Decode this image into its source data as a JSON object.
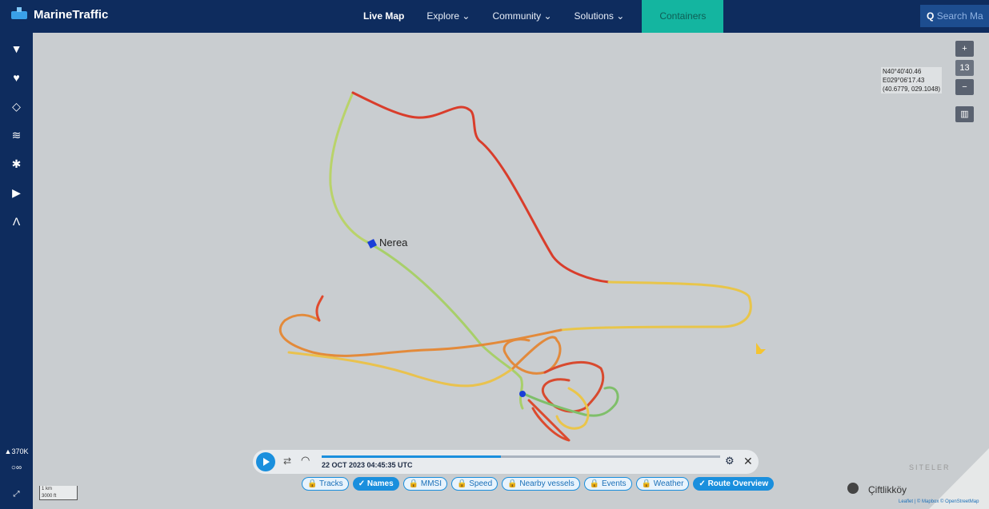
{
  "brand": {
    "name": "MarineTraffic",
    "logo_icon": "ship-icon"
  },
  "nav": {
    "live_map": "Live Map",
    "explore": "Explore",
    "community": "Community",
    "solutions": "Solutions",
    "containers": "Containers"
  },
  "search": {
    "placeholder": "Search Ma"
  },
  "sidebar": {
    "vessel_count": "370K",
    "icons": [
      "filter-icon",
      "heart-icon",
      "layers-icon",
      "wind-icon",
      "running-icon",
      "play-icon",
      "measure-icon"
    ]
  },
  "map": {
    "zoom_level": "13",
    "zoom_in": "+",
    "zoom_out": "−",
    "coords": {
      "lat": "N40°40'40.46",
      "lon": "E029°06'17.43",
      "decimal": "(40.6779, 029.1048)"
    },
    "vessel_label": "Nerea",
    "place_label": "Çiftlikköy",
    "place_small": "SITELER",
    "attribution": "Leaflet | © Mapbox © OpenStreetMap",
    "scale_km": "1 km",
    "scale_ft": "3000 ft"
  },
  "player": {
    "timestamp": "22 OCT 2023 04:45:35 UTC",
    "progress": 0.45
  },
  "chips": [
    {
      "label": "Tracks",
      "on": false
    },
    {
      "label": "Names",
      "on": true
    },
    {
      "label": "MMSI",
      "on": false
    },
    {
      "label": "Speed",
      "on": false
    },
    {
      "label": "Nearby vessels",
      "on": false
    },
    {
      "label": "Events",
      "on": false
    },
    {
      "label": "Weather",
      "on": false
    },
    {
      "label": "Route Overview",
      "on": true
    }
  ],
  "colors": {
    "nav_bg": "#0e2c5e",
    "accent": "#1a8fdd",
    "containers": "#14b5a0",
    "map_bg": "#c9cdd0"
  }
}
